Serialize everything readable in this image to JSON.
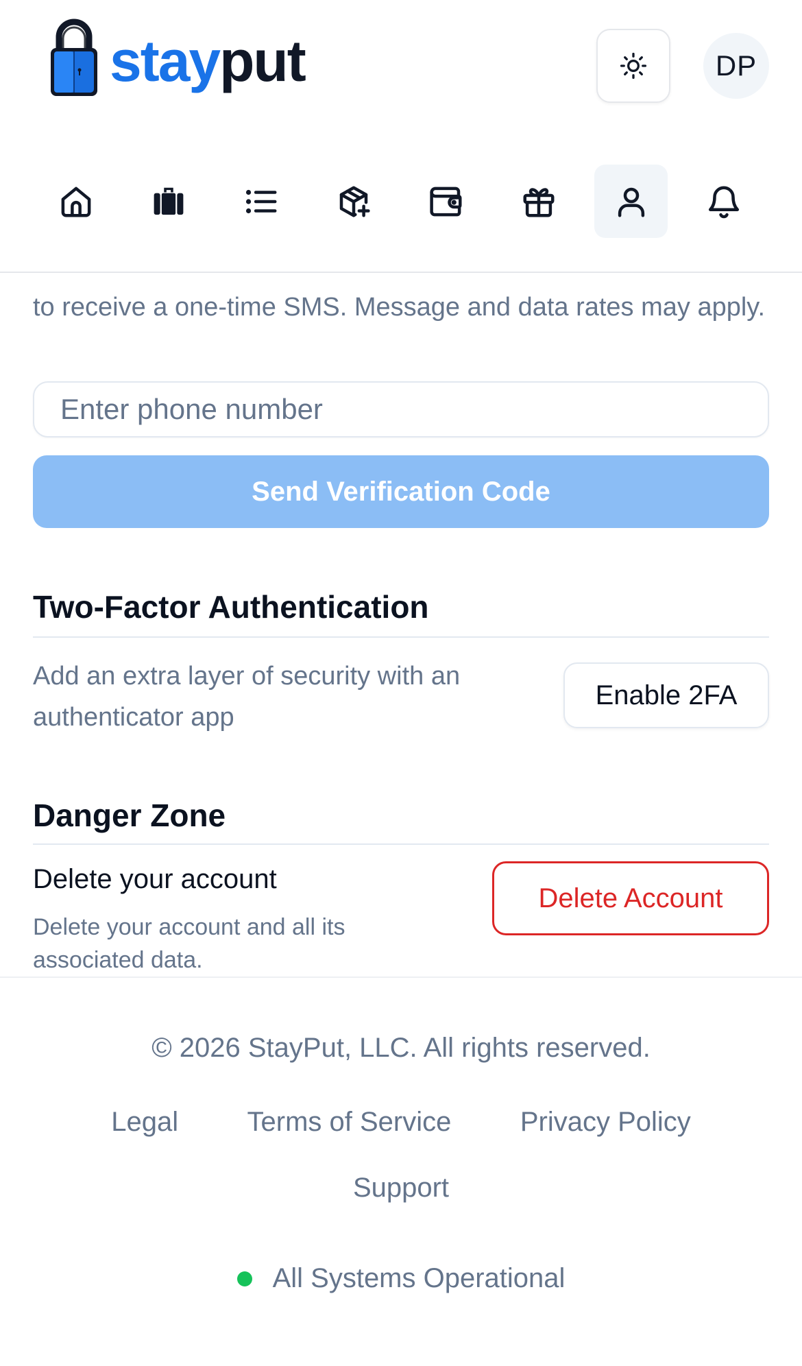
{
  "brand": {
    "stay": "stay",
    "put": "put"
  },
  "header": {
    "avatar_initials": "DP"
  },
  "nav": {
    "items": [
      {
        "name": "home",
        "active": false
      },
      {
        "name": "luggage",
        "active": false
      },
      {
        "name": "list",
        "active": false
      },
      {
        "name": "add-package",
        "active": false
      },
      {
        "name": "wallet",
        "active": false
      },
      {
        "name": "gift",
        "active": false
      },
      {
        "name": "profile",
        "active": true
      },
      {
        "name": "notifications",
        "active": false
      }
    ]
  },
  "sms": {
    "description": "to receive a one-time SMS. Message and data rates may apply.",
    "phone_placeholder": "Enter phone number",
    "send_label": "Send Verification Code"
  },
  "two_factor": {
    "title": "Two-Factor Authentication",
    "description": "Add an extra layer of security with an authenticator app",
    "button_label": "Enable 2FA"
  },
  "danger_zone": {
    "title": "Danger Zone",
    "heading": "Delete your account",
    "description": "Delete your account and all its associated data.",
    "button_label": "Delete Account"
  },
  "footer": {
    "copyright": "© 2026 StayPut, LLC. All rights reserved.",
    "links": [
      "Legal",
      "Terms of Service",
      "Privacy Policy"
    ],
    "support": "Support",
    "status": "All Systems Operational"
  },
  "colors": {
    "brand_blue": "#1a73e8",
    "danger": "#dc2626",
    "status_ok": "#16c25a",
    "button_disabled": "#8bbdf5"
  }
}
